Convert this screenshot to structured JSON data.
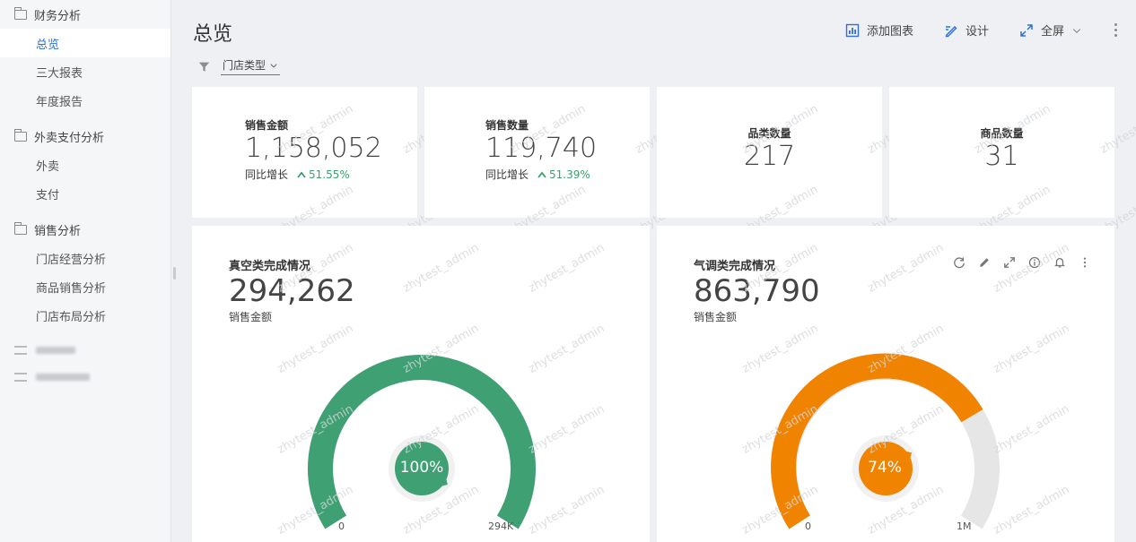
{
  "sidebar": {
    "groups": [
      {
        "label": "财务分析",
        "items": [
          "总览",
          "三大报表",
          "年度报告"
        ]
      },
      {
        "label": "外卖支付分析",
        "items": [
          "外卖",
          "支付"
        ]
      },
      {
        "label": "销售分析",
        "items": [
          "门店经营分析",
          "商品销售分析",
          "门店布局分析"
        ]
      }
    ]
  },
  "header": {
    "title": "总览",
    "add_chart": "添加图表",
    "design": "设计",
    "fullscreen": "全屏"
  },
  "filter": {
    "label": "门店类型"
  },
  "kpis": [
    {
      "label": "销售金额",
      "value": "1,158,052",
      "growth_label": "同比增长",
      "growth": "51.55%"
    },
    {
      "label": "销售数量",
      "value": "119,740",
      "growth_label": "同比增长",
      "growth": "51.39%"
    },
    {
      "label": "品类数量",
      "value": "217"
    },
    {
      "label": "商品数量",
      "value": "31"
    }
  ],
  "gauges": [
    {
      "title": "真空类完成情况",
      "value": "294,262",
      "subtitle": "销售金额",
      "percent_label": "100%",
      "percent": 1.0,
      "min_label": "0",
      "max_label": "294K",
      "color": "#3fa074"
    },
    {
      "title": "气调类完成情况",
      "value": "863,790",
      "subtitle": "销售金额",
      "percent_label": "74%",
      "percent": 0.74,
      "min_label": "0",
      "max_label": "1M",
      "color": "#f08300"
    }
  ],
  "watermark": "zhytest_admin",
  "colors": {
    "accent": "#2f6fd6",
    "up": "#3aa06c",
    "track": "#e6e6e6"
  }
}
